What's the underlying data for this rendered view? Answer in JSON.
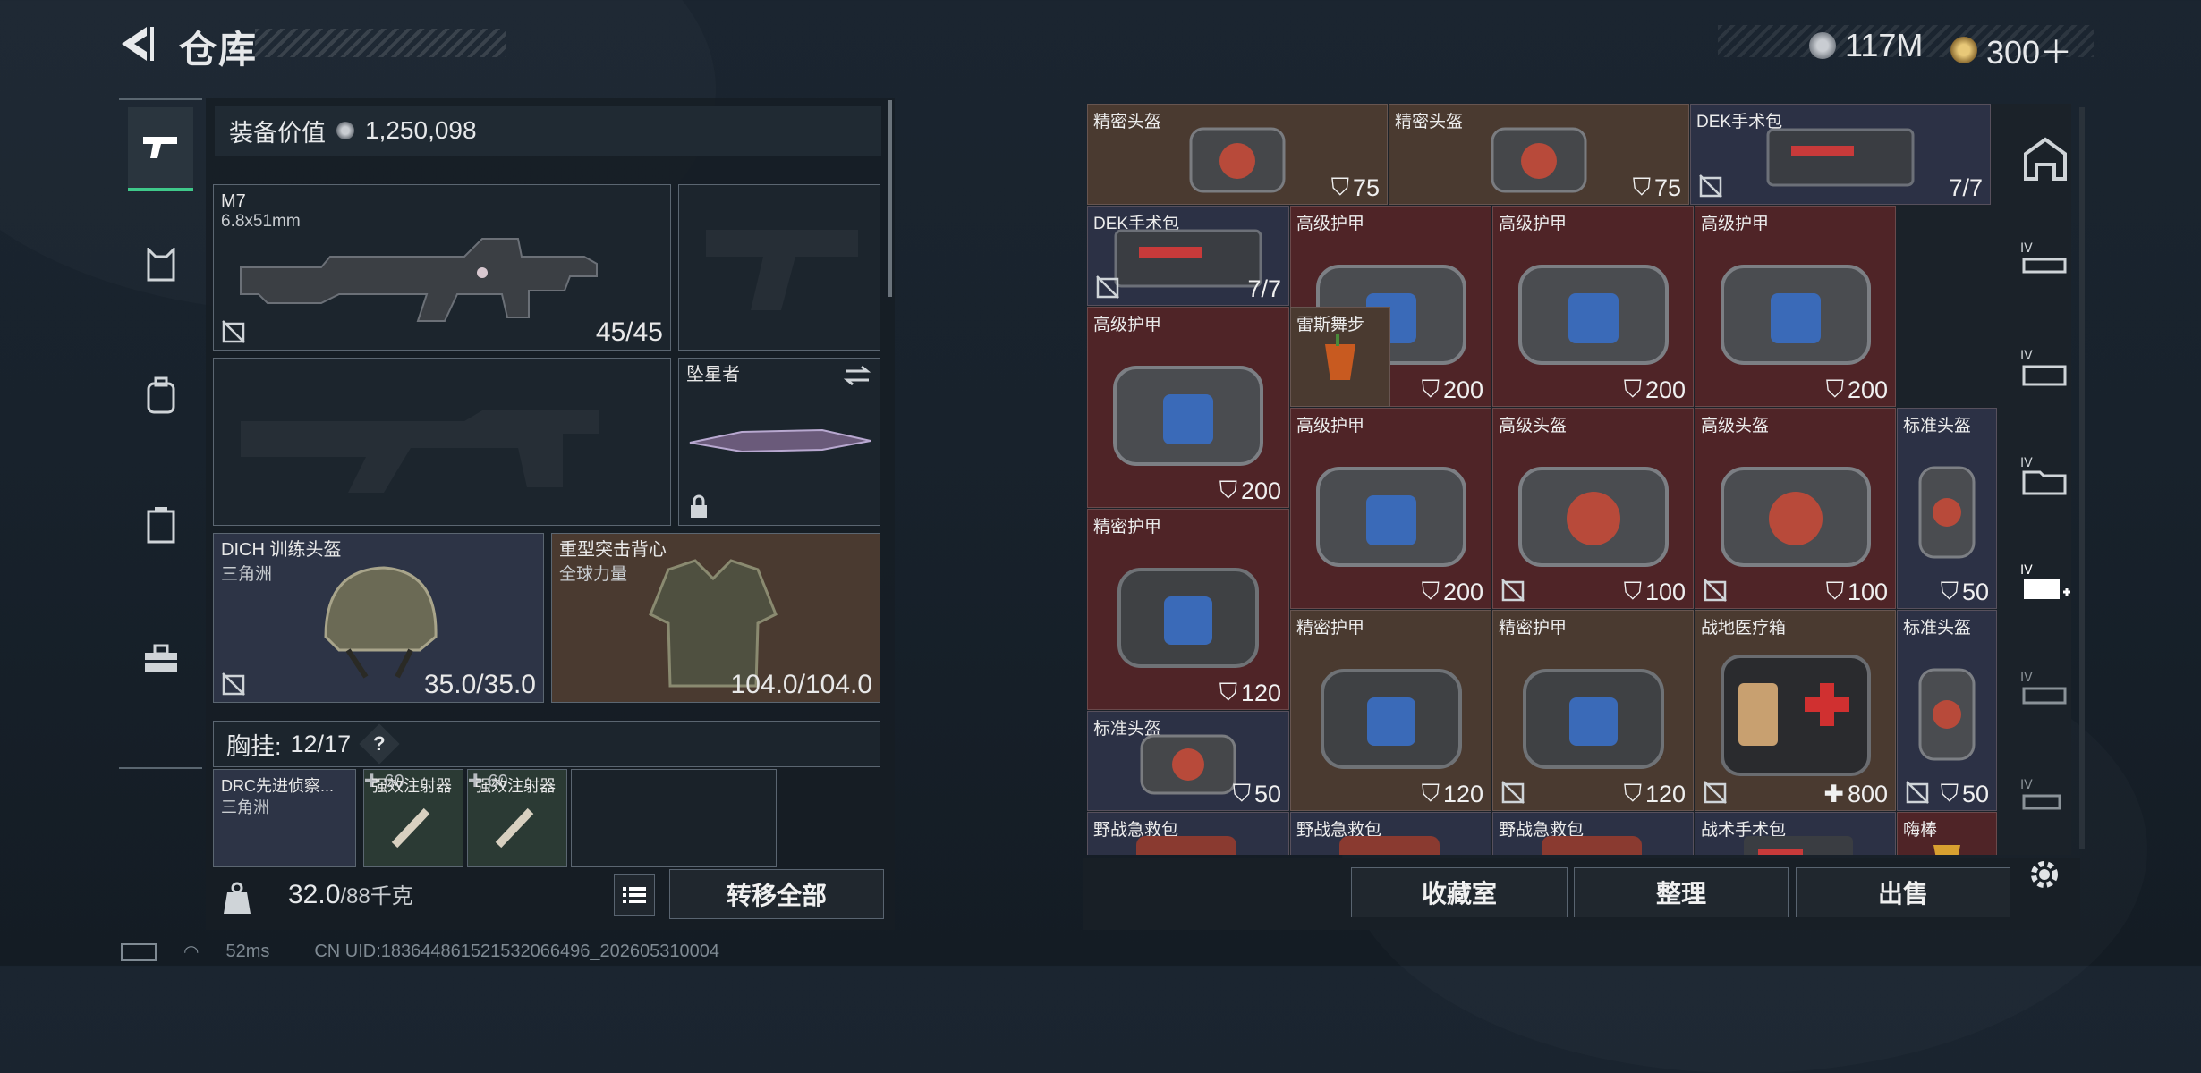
{
  "header": {
    "title": "仓库",
    "currencies": [
      {
        "icon": "coin-icon",
        "value": "117M"
      },
      {
        "icon": "token-icon",
        "value": "300＋"
      }
    ]
  },
  "equipment": {
    "value_label": "装备价值",
    "value": "1,250,098",
    "primary": {
      "name": "M7",
      "caliber": "6.8x51mm",
      "ammo": "45/45"
    },
    "melee": {
      "name": "坠星者"
    },
    "helmet": {
      "name": "DICH 训练头盔",
      "origin": "三角洲",
      "durability": "35.0/35.0"
    },
    "armor": {
      "name": "重型突击背心",
      "origin": "全球力量",
      "durability": "104.0/104.0"
    },
    "chest_label": "胸挂:",
    "chest_capacity": "12/17",
    "chest_help": "?",
    "chest_items": [
      {
        "name": "DRC先进侦察...",
        "origin": "三角洲"
      },
      {
        "name": "强效注射器",
        "count": "60"
      },
      {
        "name": "强效注射器",
        "count": "60"
      }
    ]
  },
  "bottom_bar": {
    "weight": "32.0",
    "weight_max": "/88千克",
    "transfer_label": "转移全部"
  },
  "storage": {
    "items": [
      {
        "name": "精密头盔",
        "count": "75"
      },
      {
        "name": "精密头盔",
        "count": "75"
      },
      {
        "name": "DEK手术包",
        "count": "7/7"
      },
      {
        "name": "DEK手术包",
        "count": "7/7"
      },
      {
        "name": "高级护甲",
        "count": "200"
      },
      {
        "name": "高级护甲",
        "count": "200"
      },
      {
        "name": "高级护甲",
        "count": "200"
      },
      {
        "name": "高级护甲",
        "count": "200"
      },
      {
        "name": "雷斯舞步",
        "count": ""
      },
      {
        "name": "高级护甲",
        "count": "200"
      },
      {
        "name": "高级头盔",
        "count": "100"
      },
      {
        "name": "高级头盔",
        "count": "100"
      },
      {
        "name": "标准头盔",
        "count": "50"
      },
      {
        "name": "精密护甲",
        "count": "120"
      },
      {
        "name": "精密护甲",
        "count": "120"
      },
      {
        "name": "精密护甲",
        "count": "120"
      },
      {
        "name": "战地医疗箱",
        "count": "800"
      },
      {
        "name": "标准头盔",
        "count": "50"
      },
      {
        "name": "标准头盔",
        "count": "50"
      },
      {
        "name": "野战急救包",
        "count": ""
      },
      {
        "name": "野战急救包",
        "count": ""
      },
      {
        "name": "野战急救包",
        "count": ""
      },
      {
        "name": "战术手术包",
        "count": ""
      },
      {
        "name": "嗨棒",
        "count": ""
      }
    ]
  },
  "storage_buttons": {
    "vault": "收藏室",
    "sort": "整理",
    "sell": "出售"
  },
  "status": {
    "ping": "52ms",
    "uid": "CN UID:183644861521532066496_202605310004"
  }
}
